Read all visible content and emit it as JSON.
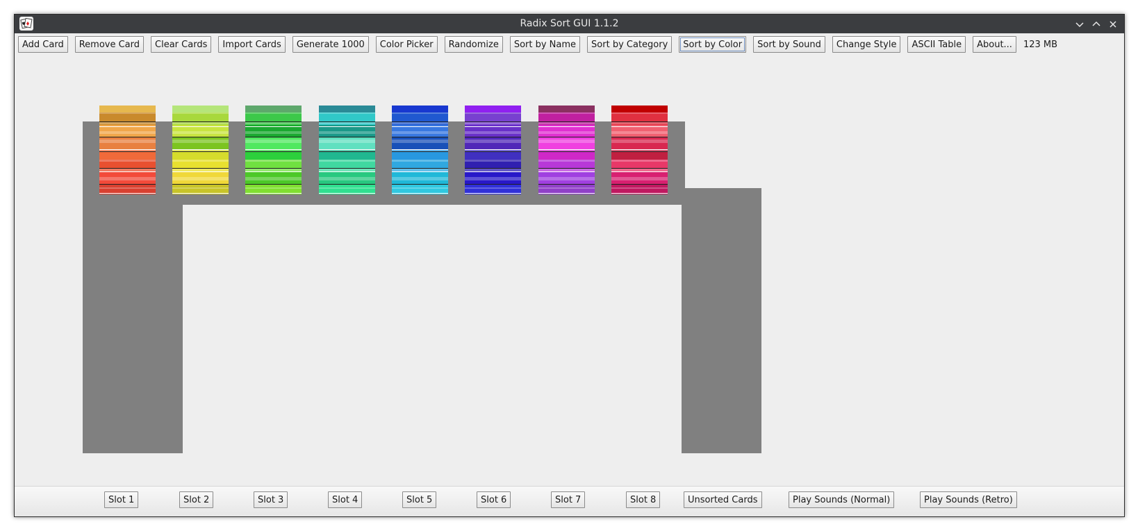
{
  "window": {
    "title": "Radix Sort GUI 1.1.2",
    "controls": [
      "minimize",
      "maximize",
      "close"
    ]
  },
  "toolbar": {
    "buttons": [
      "Add Card",
      "Remove Card",
      "Clear Cards",
      "Import Cards",
      "Generate 1000",
      "Color Picker",
      "Randomize",
      "Sort by Name",
      "Sort by Category",
      "Sort by Color",
      "Sort by Sound",
      "Change Style",
      "ASCII Table",
      "About..."
    ],
    "focused": "Sort by Color",
    "memory": "123 MB"
  },
  "piles": [
    {
      "slot": 1,
      "top_color": "#e6b84e",
      "stripes": [
        "#c98a2c",
        "#f0a64a",
        "#e88040",
        "#f06a3a",
        "#e85030",
        "#f24a3a",
        "#d84030"
      ]
    },
    {
      "slot": 2,
      "top_color": "#b5e57a",
      "stripes": [
        "#a8d83c",
        "#c8e440",
        "#7cc420",
        "#d6dc2c",
        "#e8e030",
        "#f0d83a",
        "#c8c428"
      ]
    },
    {
      "slot": 3,
      "top_color": "#5ea86c",
      "stripes": [
        "#3cc84a",
        "#1aa830",
        "#50e860",
        "#2cd03c",
        "#70e040",
        "#4cc828",
        "#80e030"
      ]
    },
    {
      "slot": 4,
      "top_color": "#2a8a96",
      "stripes": [
        "#30c8c8",
        "#1a9888",
        "#60e0c0",
        "#20b890",
        "#40d8a0",
        "#28c880",
        "#30e090"
      ]
    },
    {
      "slot": 5,
      "top_color": "#1838d0",
      "stripes": [
        "#2058d0",
        "#3878e0",
        "#1850b8",
        "#2898e0",
        "#30a8e0",
        "#20b8d8",
        "#30c8e0"
      ]
    },
    {
      "slot": 6,
      "top_color": "#9020f0",
      "stripes": [
        "#7840d0",
        "#6830c8",
        "#5028b8",
        "#4030c0",
        "#3020b0",
        "#2818c8",
        "#3030d8"
      ]
    },
    {
      "slot": 7,
      "top_color": "#8a3060",
      "stripes": [
        "#c020a0",
        "#e030d0",
        "#f040e0",
        "#d028c8",
        "#b838d8",
        "#a040e0",
        "#9040c8"
      ]
    },
    {
      "slot": 8,
      "top_color": "#c00000",
      "stripes": [
        "#e03040",
        "#f06070",
        "#d82850",
        "#c02040",
        "#e83868",
        "#d82070",
        "#c01860"
      ]
    }
  ],
  "bottom": {
    "slots": [
      "Slot 1",
      "Slot 2",
      "Slot 3",
      "Slot 4",
      "Slot 5",
      "Slot 6",
      "Slot 7",
      "Slot 8"
    ],
    "unsorted": "Unsorted Cards",
    "play_normal": "Play Sounds (Normal)",
    "play_retro": "Play Sounds (Retro)"
  },
  "colors": {
    "surface": "#808080",
    "background": "#eeeeee",
    "titlebar": "#3b3d40"
  }
}
